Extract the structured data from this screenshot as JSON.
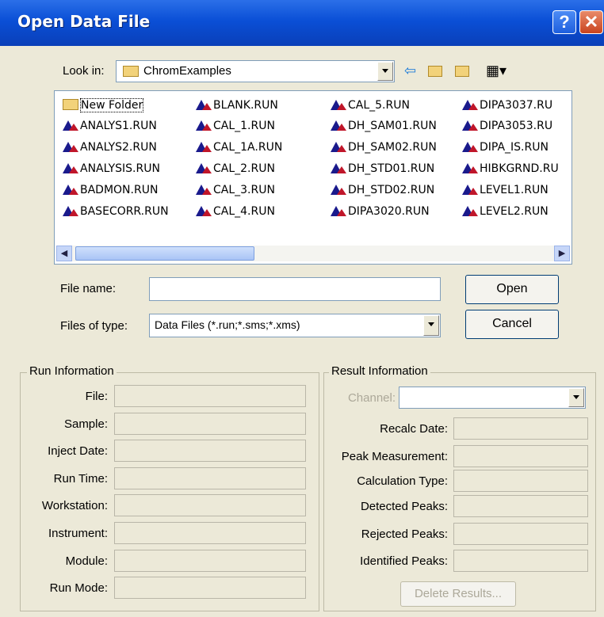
{
  "window": {
    "title": "Open Data File",
    "help_glyph": "?",
    "close_glyph": "✕"
  },
  "lookin": {
    "label": "Look in:",
    "value": "ChromExamples"
  },
  "toolbar_icons": [
    "back-icon",
    "up-folder-icon",
    "new-folder-icon",
    "view-menu-icon"
  ],
  "files": {
    "col1": [
      "New Folder",
      "ANALYS1.RUN",
      "ANALYS2.RUN",
      "ANALYSIS.RUN",
      "BADMON.RUN",
      "BASECORR.RUN"
    ],
    "col2": [
      "BLANK.RUN",
      "CAL_1.RUN",
      "CAL_1A.RUN",
      "CAL_2.RUN",
      "CAL_3.RUN",
      "CAL_4.RUN"
    ],
    "col3": [
      "CAL_5.RUN",
      "DH_SAM01.RUN",
      "DH_SAM02.RUN",
      "DH_STD01.RUN",
      "DH_STD02.RUN",
      "DIPA3020.RUN"
    ],
    "col4": [
      "DIPA3037.RU",
      "DIPA3053.RU",
      "DIPA_IS.RUN",
      "HIBKGRND.RU",
      "LEVEL1.RUN",
      "LEVEL2.RUN"
    ]
  },
  "filename": {
    "label": "File name:",
    "value": ""
  },
  "filetype": {
    "label": "Files of type:",
    "value": "Data Files (*.run;*.sms;*.xms)"
  },
  "buttons": {
    "open": "Open",
    "cancel": "Cancel",
    "delete_results": "Delete Results..."
  },
  "run_info": {
    "title": "Run Information",
    "fields": [
      "File:",
      "Sample:",
      "Inject Date:",
      "Run Time:",
      "Workstation:",
      "Instrument:",
      "Module:",
      "Run Mode:"
    ]
  },
  "result_info": {
    "title": "Result Information",
    "channel_label": "Channel:",
    "fields": [
      "Recalc Date:",
      "Peak Measurement:",
      "Calculation Type:",
      "Detected Peaks:",
      "Rejected Peaks:",
      "Identified Peaks:"
    ]
  }
}
